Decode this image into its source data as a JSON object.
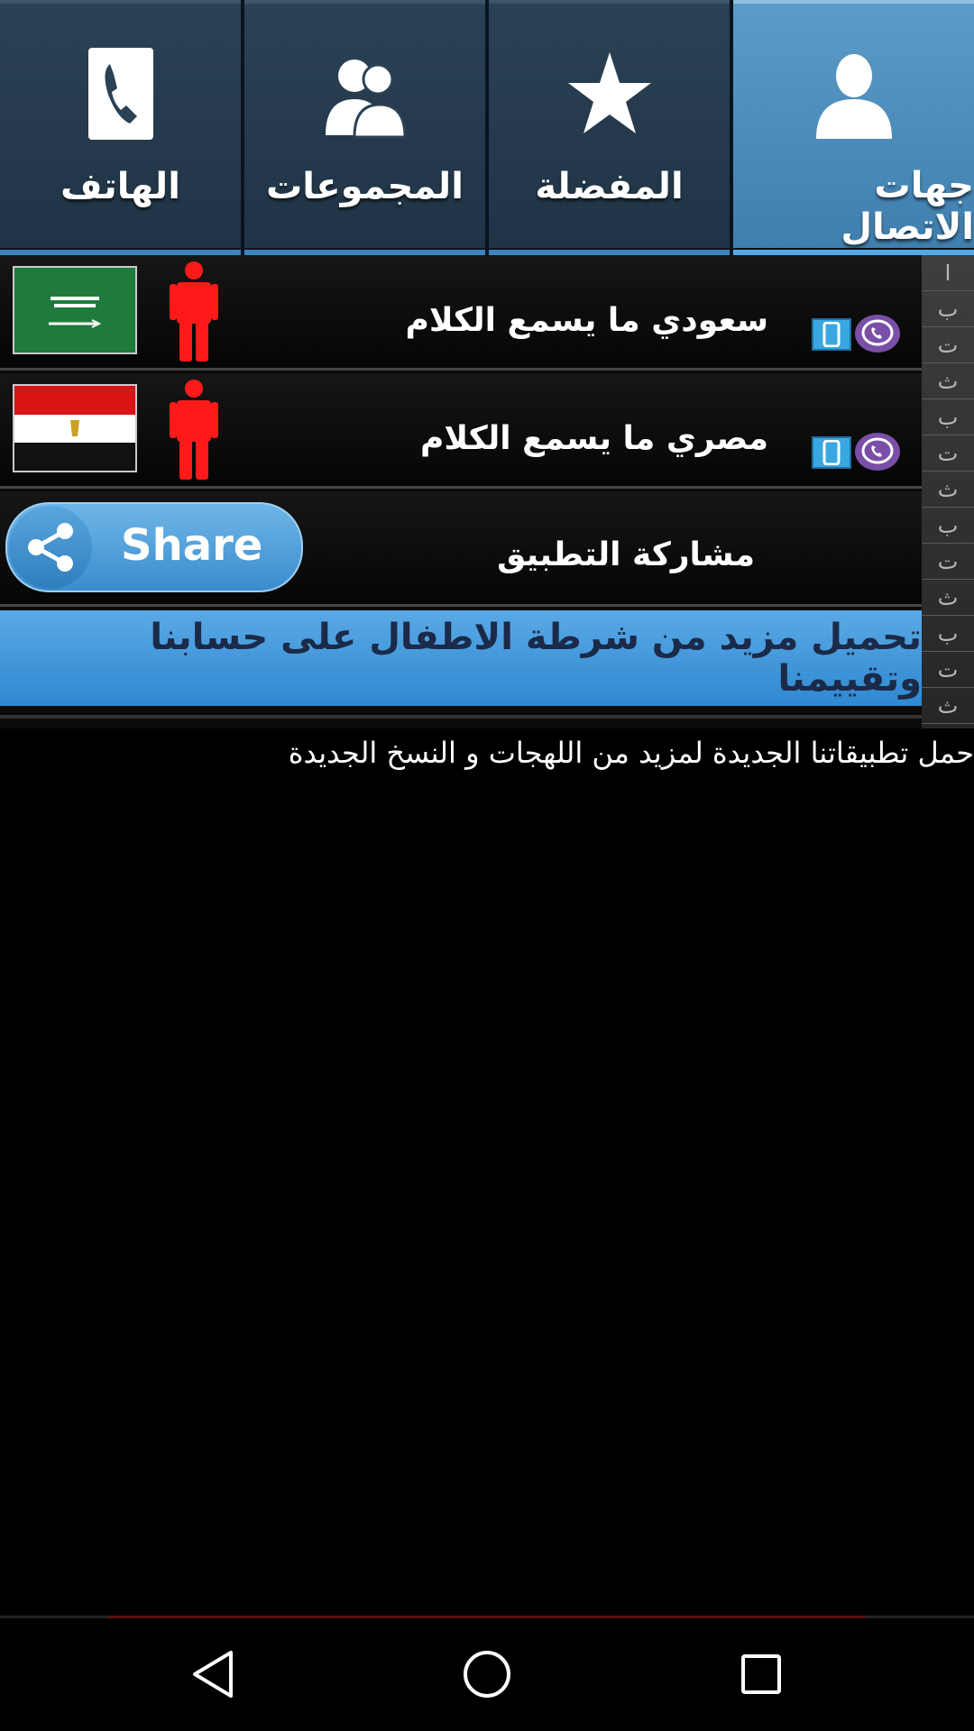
{
  "tabs": [
    {
      "label": "الهاتف",
      "icon": "phone-icon",
      "active": false
    },
    {
      "label": "المجموعات",
      "icon": "groups-icon",
      "active": false
    },
    {
      "label": "المفضلة",
      "icon": "star-icon",
      "active": false
    },
    {
      "label": "جهات الاتصال",
      "icon": "contact-icon",
      "active": true
    }
  ],
  "rows": [
    {
      "name": "سعودي ما  يسمع الكلام",
      "flag": "saudi-flag-icon"
    },
    {
      "name": "مصري ما يسمع الكلام",
      "flag": "egypt-flag-icon"
    }
  ],
  "share": {
    "button_label": "Share",
    "label": "مشاركة التطبيق"
  },
  "download_banner": "تحميل مزيد من شرطة الاطفال على حسابنا وتقييمنا",
  "promo_text": "حمل تطبيقاتنا الجديدة لمزيد من اللهجات و النسخ الجديدة",
  "index_letters": [
    "ا",
    "ب",
    "ت",
    "ث",
    "ب",
    "ت",
    "ث",
    "ب",
    "ت",
    "ث",
    "ب",
    "ت",
    "ث"
  ],
  "colors": {
    "accent": "#3b86c1",
    "person": "#ff1a1a",
    "viber": "#7a4fa8"
  }
}
